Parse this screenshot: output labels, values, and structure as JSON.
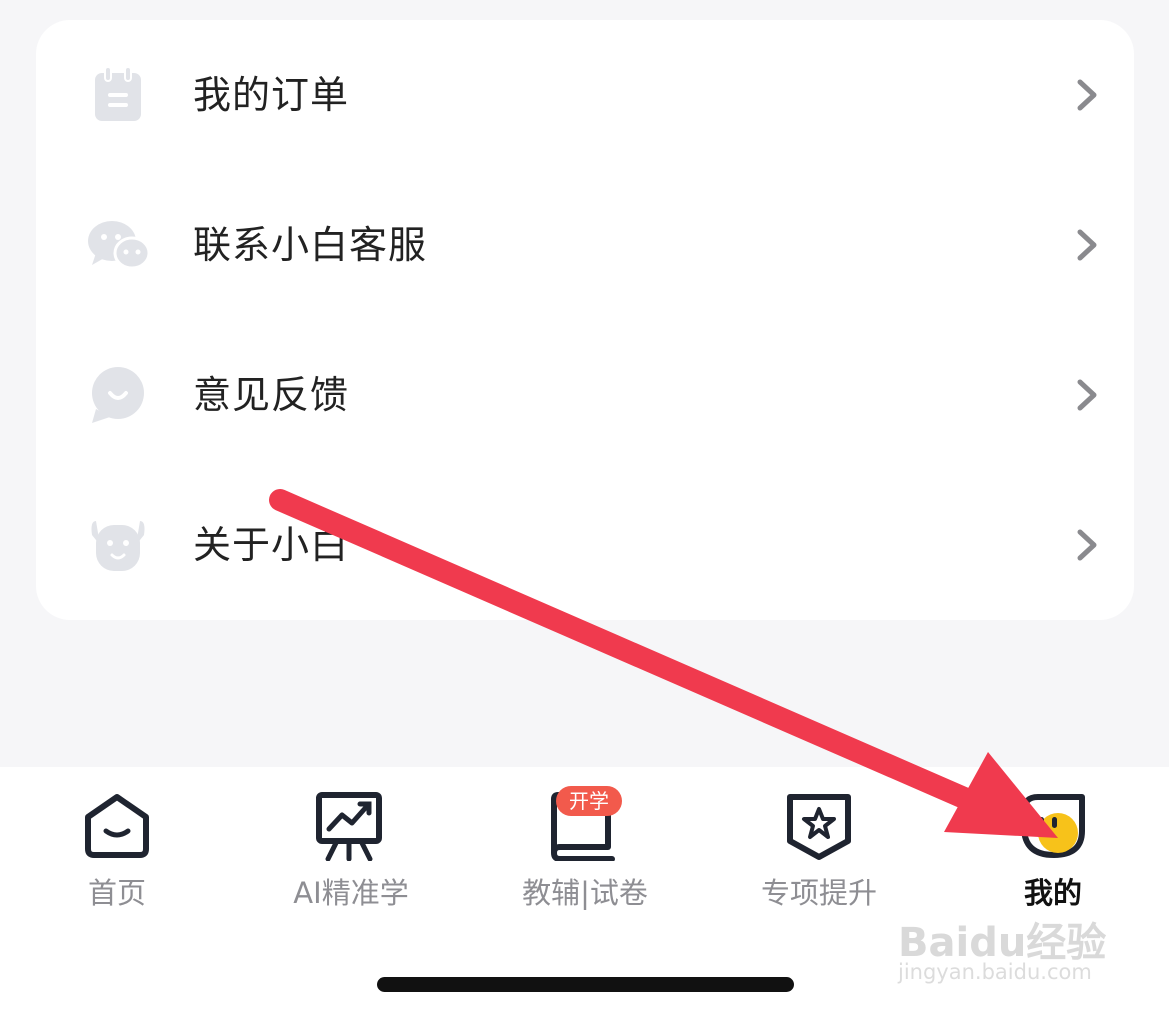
{
  "menu": {
    "items": [
      {
        "label": "我的订单",
        "icon": "order-notebook-icon"
      },
      {
        "label": "联系小白客服",
        "icon": "wechat-chat-icon"
      },
      {
        "label": "意见反馈",
        "icon": "feedback-smile-icon"
      },
      {
        "label": "关于小白",
        "icon": "dog-face-icon"
      }
    ]
  },
  "tabbar": {
    "tabs": [
      {
        "label": "首页",
        "icon": "home-icon"
      },
      {
        "label": "AI精准学",
        "icon": "chart-board-icon"
      },
      {
        "label": "教辅|试卷",
        "icon": "book-icon",
        "badge": "开学"
      },
      {
        "label": "专项提升",
        "icon": "star-shield-icon"
      },
      {
        "label": "我的",
        "icon": "profile-face-icon",
        "active": true
      }
    ]
  },
  "watermark": {
    "brand": "Baidu经验",
    "url": "jingyan.baidu.com"
  },
  "colors": {
    "accent_red": "#f03a4e",
    "badge_red": "#f25a4c",
    "active_yellow": "#f7c21a",
    "inactive_gray": "#8e8e93"
  }
}
